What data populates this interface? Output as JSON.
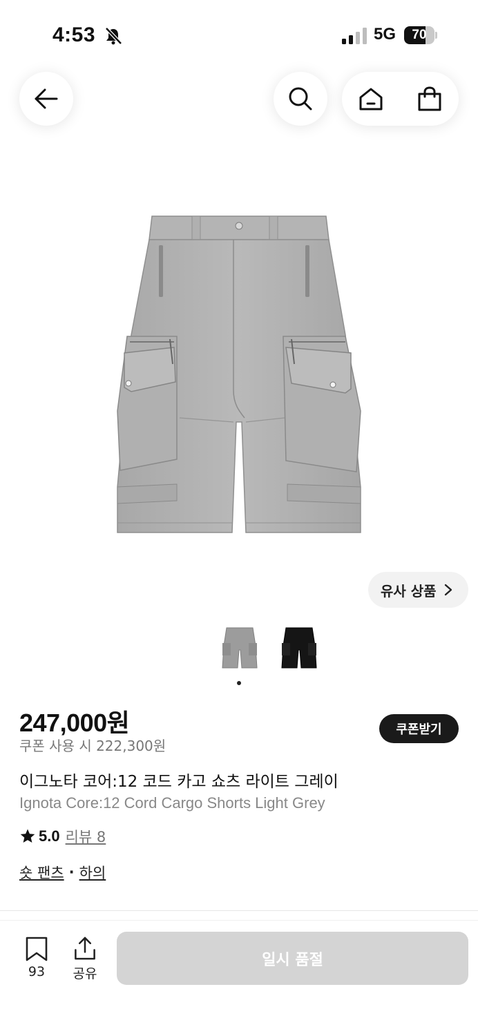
{
  "status_bar": {
    "time": "4:53",
    "network": "5G",
    "battery_level": "70",
    "battery_fraction": 0.7
  },
  "nav": {
    "back_icon": "arrow-left-icon",
    "search_icon": "search-icon",
    "home_icon": "home-icon",
    "cart_icon": "shopping-bag-icon"
  },
  "product": {
    "similar_label": "유사 상품",
    "thumbnails": [
      {
        "color": "light grey",
        "hex": "#9c9c9c"
      },
      {
        "color": "black",
        "hex": "#151515"
      }
    ],
    "active_thumbnail": 1,
    "price": "247,000원",
    "coupon_price": "쿠폰 사용 시 222,300원",
    "coupon_button": "쿠폰받기",
    "name_ko": "이그노타 코어:12 코드 카고 쇼츠 라이트 그레이",
    "name_en": "Ignota Core:12 Cord Cargo Shorts Light Grey",
    "rating": "5.0",
    "reviews": "리뷰 8",
    "categories": [
      "숏 팬츠",
      "하의"
    ],
    "category_separator": "·"
  },
  "bottom_bar": {
    "wishlist_count": "93",
    "share_label": "공유",
    "buy_label": "일시 품절"
  },
  "colors": {
    "primary_text": "#111111",
    "muted_text": "#777777",
    "disabled_button": "#d4d4d4",
    "dark_button": "#1a1a1a"
  }
}
